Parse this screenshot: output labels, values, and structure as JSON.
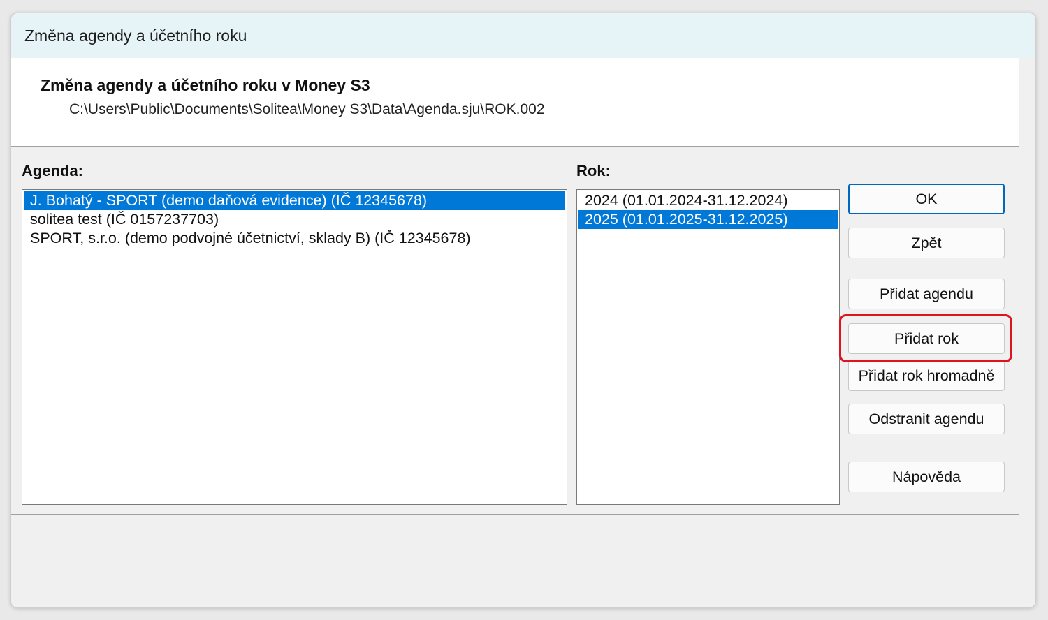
{
  "window": {
    "title": "Změna agendy a účetního roku"
  },
  "header": {
    "title": "Změna agendy a účetního roku v Money S3",
    "path": "C:\\Users\\Public\\Documents\\Solitea\\Money S3\\Data\\Agenda.sju\\ROK.002"
  },
  "agenda": {
    "label": "Agenda:",
    "items": [
      {
        "text": "J. Bohatý - SPORT (demo daňová evidence) (IČ 12345678)",
        "selected": true
      },
      {
        "text": "solitea test (IČ 0157237703)",
        "selected": false
      },
      {
        "text": "SPORT, s.r.o. (demo podvojné účetnictví, sklady B) (IČ 12345678)",
        "selected": false
      }
    ]
  },
  "rok": {
    "label": "Rok:",
    "items": [
      {
        "text": "2024 (01.01.2024-31.12.2024)",
        "selected": false
      },
      {
        "text": "2025 (01.01.2025-31.12.2025)",
        "selected": true
      }
    ]
  },
  "buttons": {
    "ok": "OK",
    "zpet": "Zpět",
    "pridat_agendu": "Přidat agendu",
    "pridat_rok": "Přidat rok",
    "pridat_rok_hromadne": "Přidat rok hromadně",
    "odstranit_agendu": "Odstranit agendu",
    "napoveda": "Nápověda"
  },
  "colors": {
    "selection": "#0078d7",
    "highlight_annotation": "#e0141e",
    "default_button_border": "#0067c0"
  }
}
